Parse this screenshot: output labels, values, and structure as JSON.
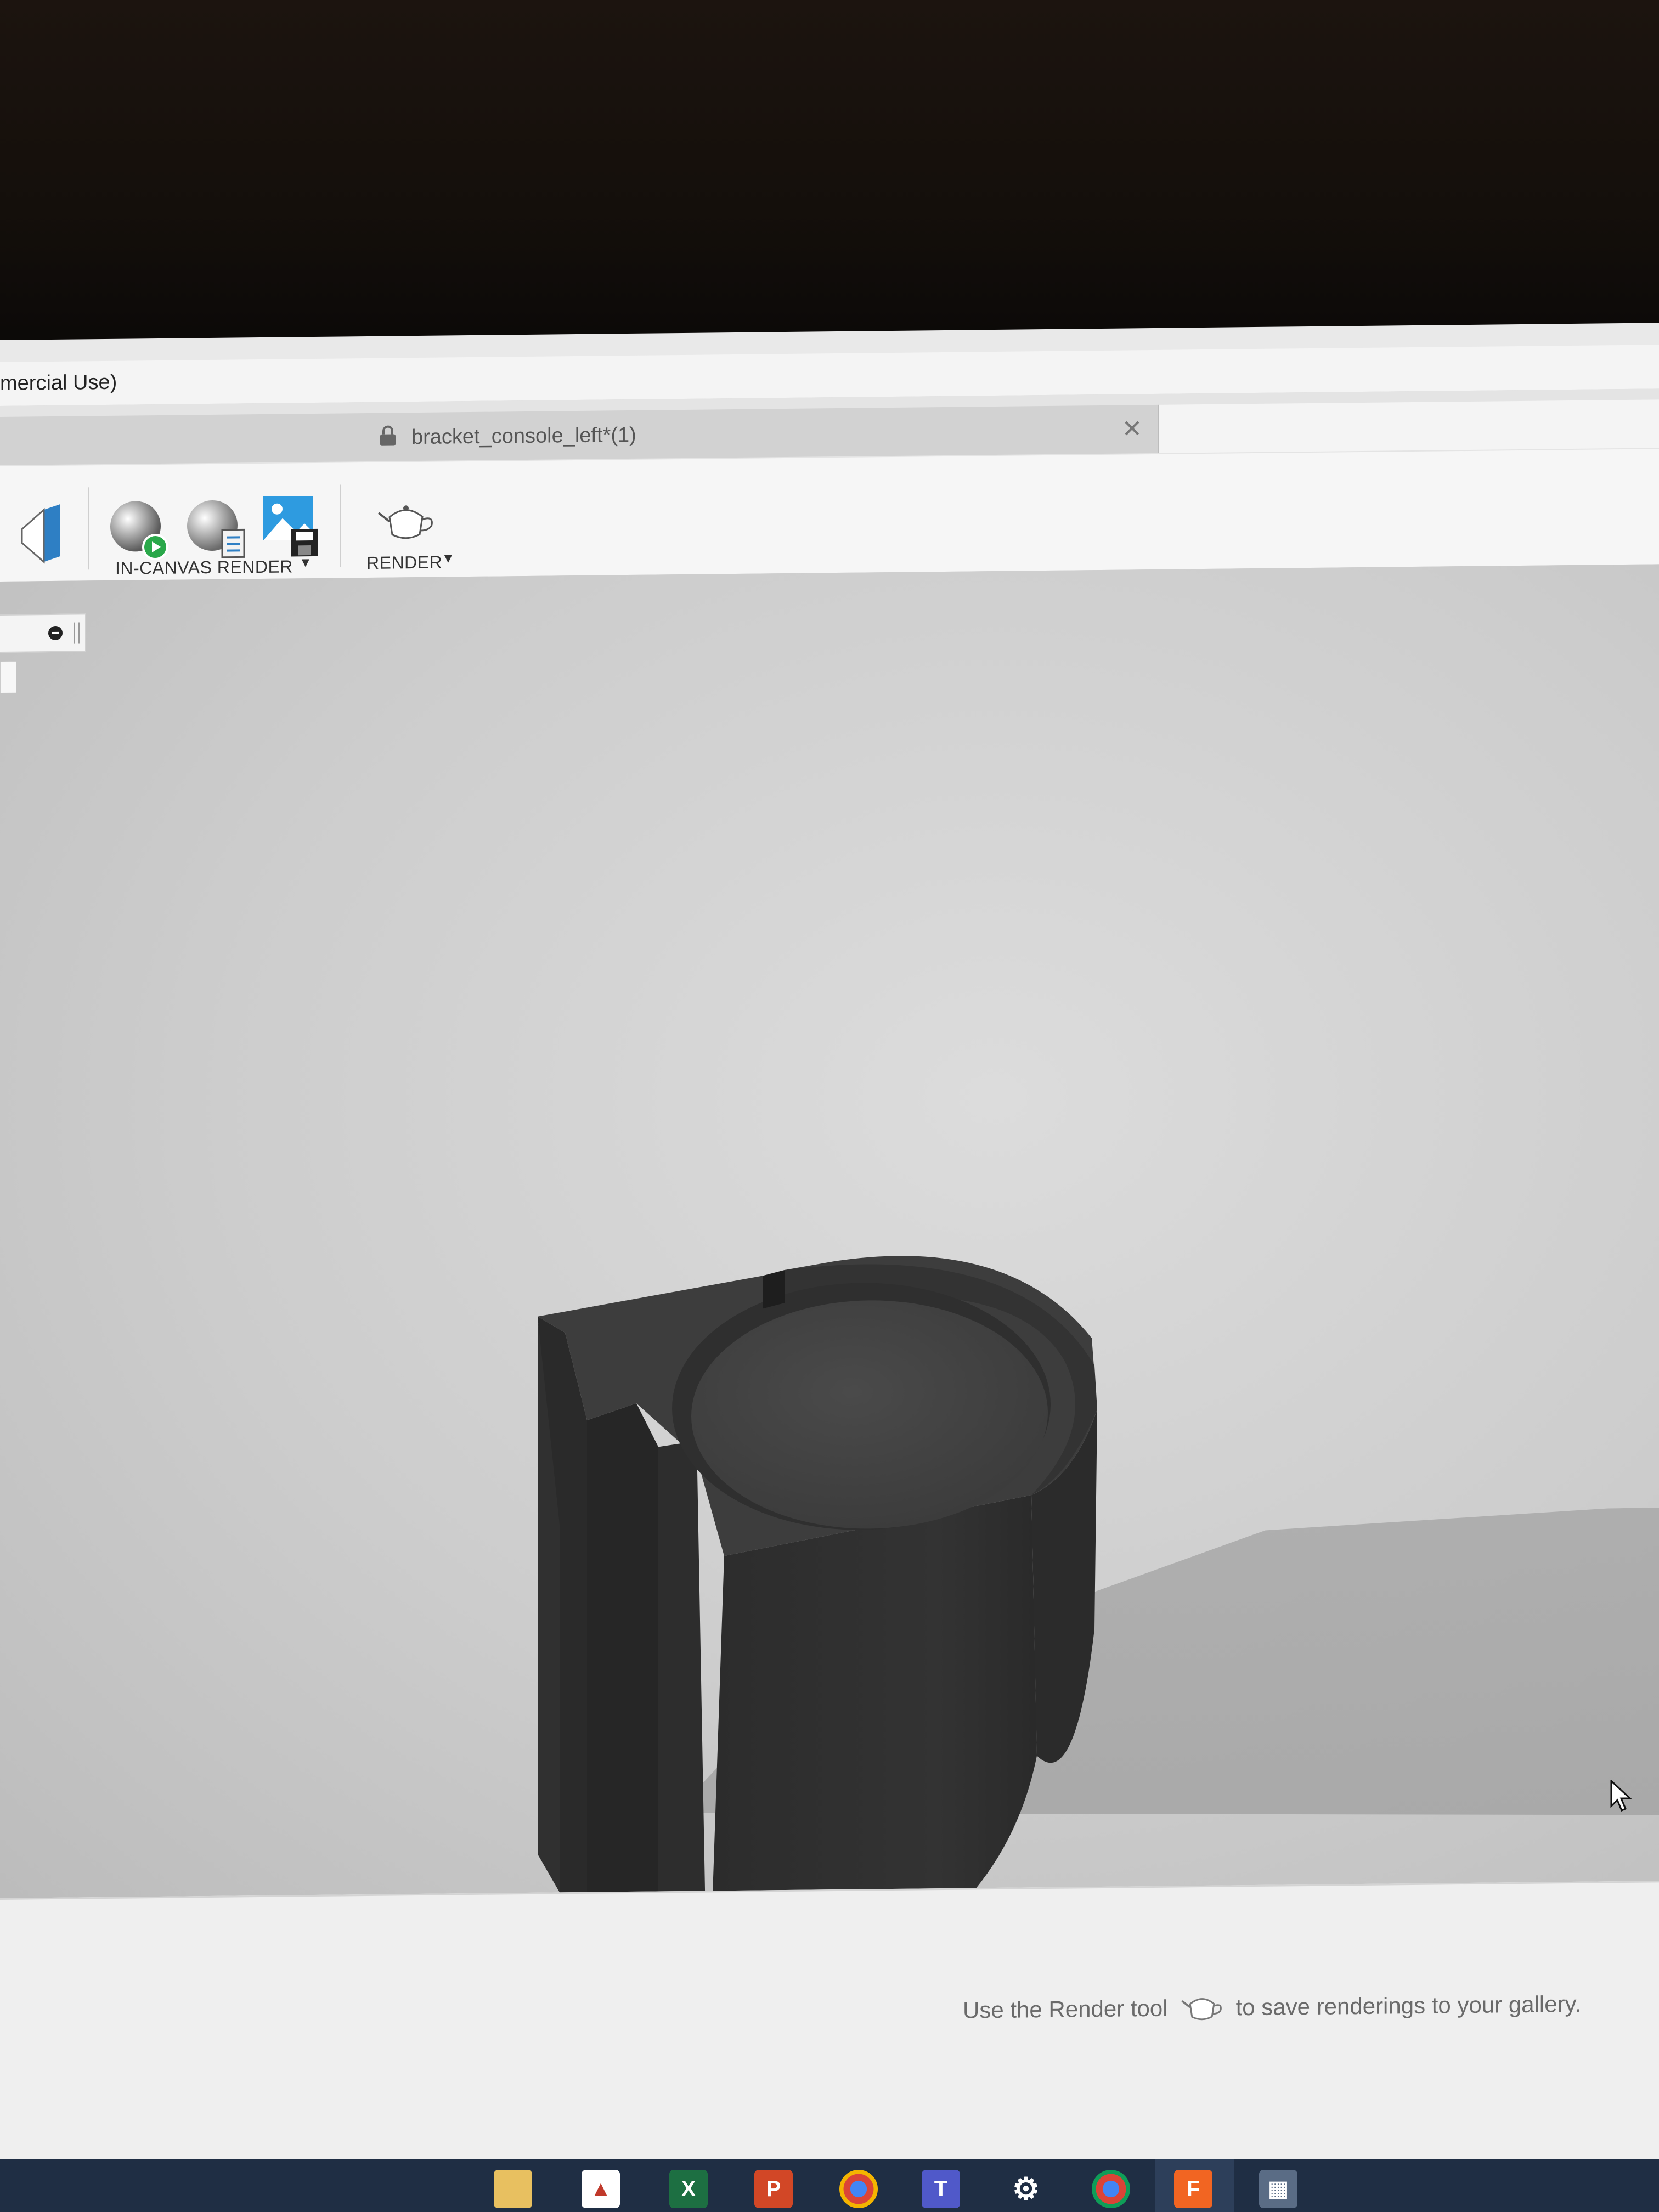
{
  "window": {
    "title": "mercial Use)"
  },
  "tabs": [
    {
      "label": "bracket_console_left*(1)",
      "locked": true,
      "active": true
    }
  ],
  "toolbar": {
    "groups": [
      {
        "label": "IN-CANVAS RENDER",
        "icons": [
          "start-render-icon",
          "render-settings-icon",
          "capture-image-icon"
        ]
      },
      {
        "label": "RENDER",
        "icons": [
          "teapot-render-icon"
        ]
      }
    ]
  },
  "navbar": {
    "tools": [
      "orbit-icon",
      "look-at-icon",
      "pan-icon",
      "zoom-icon",
      "fit-icon",
      "display-settings-icon",
      "grid-settings-icon"
    ]
  },
  "gallery": {
    "hint_before": "Use the Render tool",
    "hint_after": "to save renderings to your gallery."
  },
  "taskbar": {
    "apps": [
      "file-explorer-icon",
      "autodesk-app-icon",
      "excel-icon",
      "powerpoint-icon",
      "chrome-icon",
      "teams-icon",
      "settings-icon",
      "chrome-profile-icon",
      "fusion-360-icon",
      "calculator-icon"
    ],
    "active_app": "fusion-360-icon",
    "colors": {
      "bar": "#1f2e44",
      "fusion": "#f26522",
      "excel": "#1d6f42",
      "powerpoint": "#d24726",
      "teams": "#5059c9"
    }
  }
}
